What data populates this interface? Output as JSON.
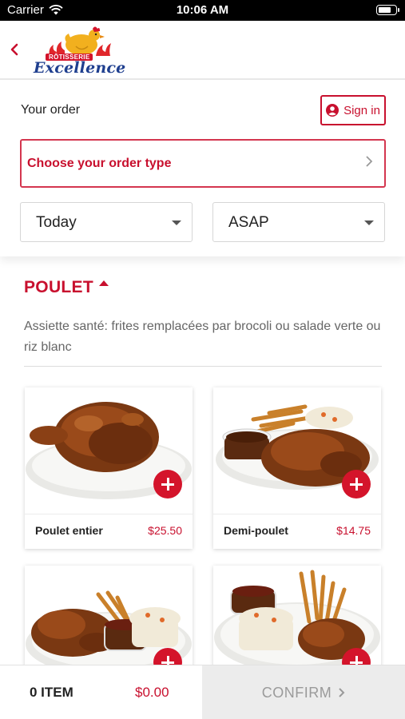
{
  "status_bar": {
    "carrier": "Carrier",
    "time": "10:06 AM",
    "battery_level": 0.8
  },
  "header": {
    "back_icon": "chevron-left-icon",
    "logo": {
      "banner": "RÔTISSERIE",
      "script": "Excellence"
    }
  },
  "order_panel": {
    "title": "Your order",
    "sign_in_label": "Sign in",
    "order_type_label": "Choose your order type",
    "day_select": "Today",
    "time_select": "ASAP"
  },
  "menu": {
    "section_title": "POULET",
    "section_description": "Assiette santé: frites remplacées par brocoli ou salade verte ou riz blanc",
    "items": [
      {
        "name": "Poulet entier",
        "price": "$25.50"
      },
      {
        "name": "Demi-poulet",
        "price": "$14.75"
      },
      {
        "name": "",
        "price": ""
      },
      {
        "name": "",
        "price": ""
      }
    ]
  },
  "cart": {
    "item_count": "0 ITEM",
    "total": "$0.00",
    "confirm_label": "CONFIRM"
  },
  "colors": {
    "accent": "#c8102e",
    "border_accent": "#d4364f",
    "muted": "#9a9a9a"
  }
}
